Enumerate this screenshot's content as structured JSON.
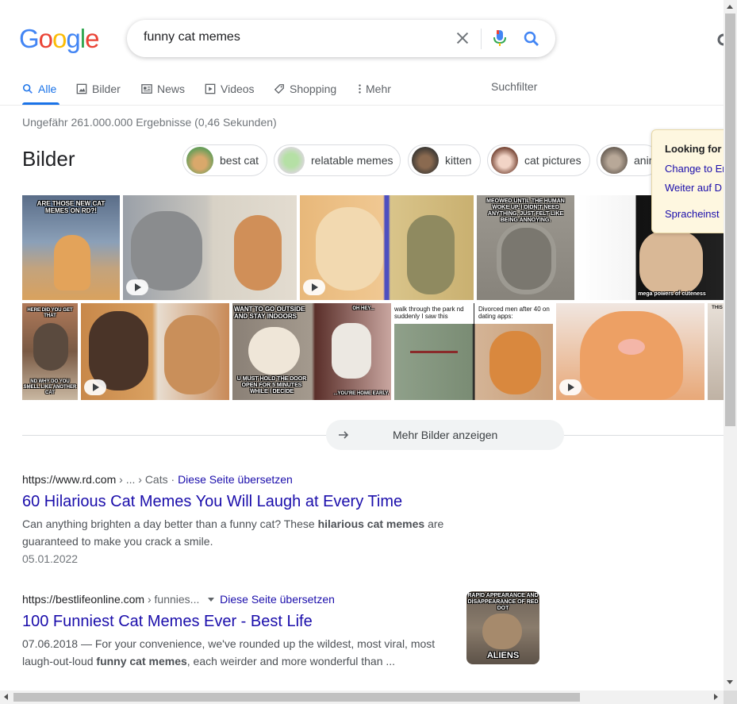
{
  "search": {
    "query": "funny cat memes"
  },
  "logo": [
    "G",
    "o",
    "o",
    "g",
    "l",
    "e"
  ],
  "tabs": [
    {
      "label": "Alle",
      "icon": "search-icon"
    },
    {
      "label": "Bilder",
      "icon": "image-icon"
    },
    {
      "label": "News",
      "icon": "news-icon"
    },
    {
      "label": "Videos",
      "icon": "video-icon"
    },
    {
      "label": "Shopping",
      "icon": "tag-icon"
    },
    {
      "label": "Mehr",
      "icon": "more-vert-icon"
    }
  ],
  "suchfilter": "Suchfilter",
  "stats": "Ungefähr 261.000.000 Ergebnisse (0,46 Sekunden)",
  "images": {
    "heading": "Bilder",
    "chips": [
      "best cat",
      "relatable memes",
      "kitten",
      "cat pictures",
      "animals"
    ],
    "captions": {
      "rd": "ARE THOSE NEW CAT MEMES ON RD?!",
      "meowed": "MEOWED UNTIL THE HUMAN WOKE UP. I DIDN'T NEED ANYTHING. JUST FELT LIKE BEING ANNOYING.",
      "cuteness": "mega powers of cuteness",
      "outside": "WANT TO GO OUTSIDE AND STAY INDOORS",
      "door": "U MUST HOLD THE DOOR OPEN FOR 5 MINUTES WHILE I DECIDE",
      "ohhey": "OH HEY...",
      "home": "...YOU'RE HOME EARLY.",
      "park": "walk through the park nd suddenly I saw this",
      "divorced": "Divorced men after 40 on dating apps:",
      "grumpy_top": "HERE DID YOU GET THAT",
      "grumpy_bot": "ND WHY DO YOU SMELL LIKE ANOTHER CAT"
    },
    "more_button": "Mehr Bilder anzeigen"
  },
  "results": [
    {
      "url": "https://www.rd.com",
      "path": " › ... › Cats",
      "translate": "Diese Seite übersetzen",
      "title": "60 Hilarious Cat Memes You Will Laugh at Every Time",
      "snippet_pre": "Can anything brighten a day better than a funny cat? These ",
      "snippet_bold": "hilarious cat memes",
      "snippet_post": " are guaranteed to make you crack a smile.",
      "date": "05.01.2022"
    },
    {
      "url": "https://bestlifeonline.com",
      "path": " › funnies...",
      "translate": "Diese Seite übersetzen",
      "title": "100 Funniest Cat Memes Ever - Best Life",
      "snippet_pre": "07.06.2018 — For your convenience, we've rounded up the wildest, most viral, most laugh-out-loud ",
      "snippet_bold": "funny cat memes",
      "snippet_post": ", each weirder and more wonderful than ...",
      "thumb_top": "RAPID APPEARANCE AND DISAPPEARANCE OF RED DOT",
      "thumb_bottom": "ALIENS"
    }
  ],
  "popup": {
    "title": "Looking for",
    "links": [
      "Change to En",
      "Weiter auf D",
      "Spracheinst"
    ]
  },
  "colors": {
    "link": "#1a0dab",
    "accent": "#1a73e8",
    "popup_bg": "#fef7e0"
  }
}
